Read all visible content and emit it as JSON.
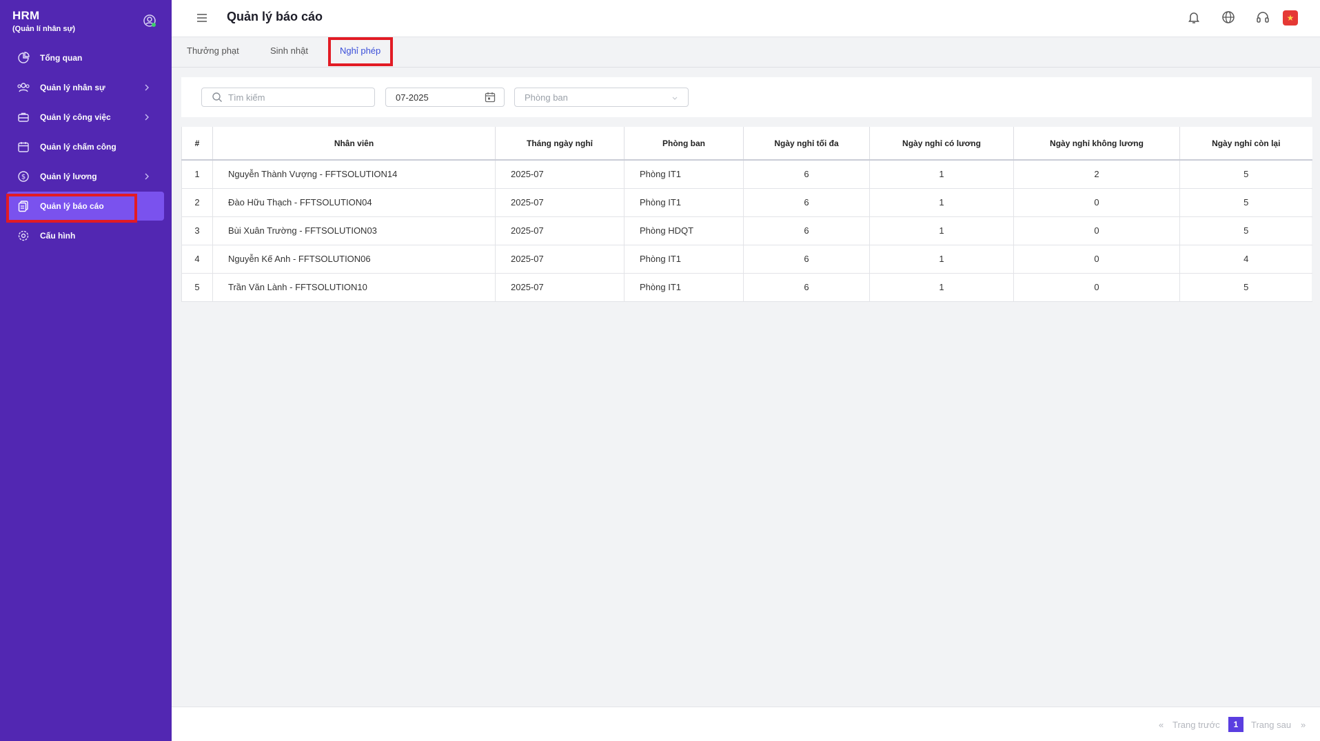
{
  "sidebar": {
    "brand_title": "HRM",
    "brand_subtitle": "(Quản lí nhân sự)",
    "items": [
      {
        "label": "Tổng quan",
        "icon": "pie-chart-icon",
        "has_chevron": false,
        "active": false
      },
      {
        "label": "Quản lý nhân sự",
        "icon": "users-icon",
        "has_chevron": true,
        "active": false
      },
      {
        "label": "Quản lý công việc",
        "icon": "briefcase-icon",
        "has_chevron": true,
        "active": false
      },
      {
        "label": "Quản lý chấm công",
        "icon": "calendar-icon",
        "has_chevron": false,
        "active": false
      },
      {
        "label": "Quản lý lương",
        "icon": "dollar-icon",
        "has_chevron": true,
        "active": false
      },
      {
        "label": "Quản lý báo cáo",
        "icon": "report-icon",
        "has_chevron": false,
        "active": true
      },
      {
        "label": "Cấu hình",
        "icon": "gear-icon",
        "has_chevron": false,
        "active": false
      }
    ]
  },
  "header": {
    "title": "Quản lý báo cáo"
  },
  "tabs": [
    {
      "label": "Thưởng phạt",
      "active": false
    },
    {
      "label": "Sinh nhật",
      "active": false
    },
    {
      "label": "Nghỉ phép",
      "active": true
    }
  ],
  "filters": {
    "search_placeholder": "Tìm kiếm",
    "month_value": "07-2025",
    "department_placeholder": "Phòng ban"
  },
  "table": {
    "headers": [
      "#",
      "Nhân viên",
      "Tháng ngày nghỉ",
      "Phòng ban",
      "Ngày nghỉ tối đa",
      "Ngày nghỉ có lương",
      "Ngày nghỉ không lương",
      "Ngày nghỉ còn lại"
    ],
    "rows": [
      [
        "1",
        "Nguyễn Thành Vượng - FFTSOLUTION14",
        "2025-07",
        "Phòng IT1",
        "6",
        "1",
        "2",
        "5"
      ],
      [
        "2",
        "Đào Hữu Thạch - FFTSOLUTION04",
        "2025-07",
        "Phòng IT1",
        "6",
        "1",
        "0",
        "5"
      ],
      [
        "3",
        "Bùi Xuân Trường - FFTSOLUTION03",
        "2025-07",
        "Phòng HDQT",
        "6",
        "1",
        "0",
        "5"
      ],
      [
        "4",
        "Nguyễn Kế Anh - FFTSOLUTION06",
        "2025-07",
        "Phòng IT1",
        "6",
        "1",
        "0",
        "4"
      ],
      [
        "5",
        "Trần Văn Lành - FFTSOLUTION10",
        "2025-07",
        "Phòng IT1",
        "6",
        "1",
        "0",
        "5"
      ]
    ]
  },
  "pagination": {
    "prev_label": "Trang trước",
    "next_label": "Trang sau",
    "current_page": "1",
    "prev_arrow": "«",
    "next_arrow": "»"
  },
  "colors": {
    "sidebar_bg": "#5227b2",
    "sidebar_active": "#7a52ee",
    "accent": "#3b4fd9",
    "highlight": "#e21b24"
  }
}
